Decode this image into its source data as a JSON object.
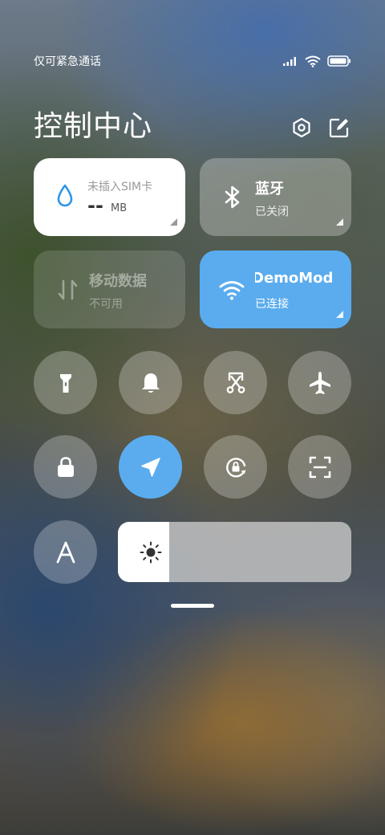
{
  "status_bar": {
    "carrier_text": "仅可紧急通话"
  },
  "header": {
    "title": "控制中心",
    "settings_icon": "hexagon-settings-icon",
    "edit_icon": "edit-icon"
  },
  "tiles": {
    "data_usage": {
      "label": "未插入SIM卡",
      "value": "--",
      "unit": "MB",
      "icon": "water-drop-icon"
    },
    "bluetooth": {
      "label": "蓝牙",
      "status": "已关闭",
      "icon": "bluetooth-icon"
    },
    "mobile_data": {
      "label": "移动数据",
      "status": "不可用",
      "icon": "data-arrows-icon"
    },
    "wifi": {
      "label": "DemoMod",
      "status": "已连接",
      "icon": "wifi-icon",
      "active_color": "#5aacee"
    }
  },
  "toggles": [
    {
      "name": "flashlight",
      "icon": "flashlight-icon",
      "active": false
    },
    {
      "name": "ring",
      "icon": "bell-icon",
      "active": false
    },
    {
      "name": "screenshot",
      "icon": "scissors-icon",
      "active": false
    },
    {
      "name": "airplane-mode",
      "icon": "airplane-icon",
      "active": false
    },
    {
      "name": "lock-screen",
      "icon": "lock-icon",
      "active": false
    },
    {
      "name": "location",
      "icon": "location-arrow-icon",
      "active": true
    },
    {
      "name": "rotation-lock",
      "icon": "rotation-lock-icon",
      "active": false
    },
    {
      "name": "scanner",
      "icon": "scan-icon",
      "active": false
    },
    {
      "name": "font-size",
      "icon": "font-a-icon",
      "active": false
    }
  ],
  "brightness": {
    "icon": "sun-icon",
    "level": 0.22
  },
  "colors": {
    "accent": "#5aacee",
    "tile_light": "#ffffff"
  }
}
